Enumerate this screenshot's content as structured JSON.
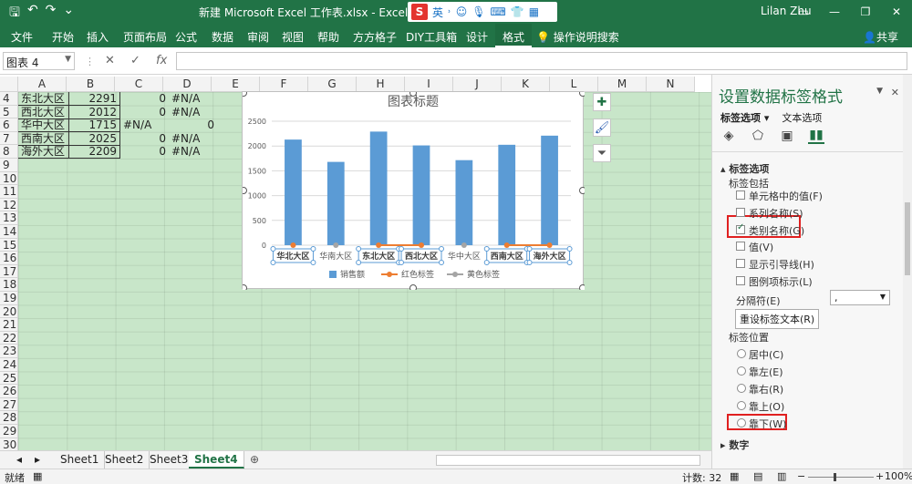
{
  "titlebar": {
    "title": "新建 Microsoft Excel 工作表.xlsx  -  Excel",
    "ime_label": "英",
    "ime_logo": "S",
    "user": "Lilan Zhu",
    "btn_restore": "▭",
    "btn_minimize": "—",
    "btn_maximize": "❐",
    "btn_close": "✕"
  },
  "ribbon": {
    "tabs": [
      "文件",
      "开始",
      "插入",
      "页面布局",
      "公式",
      "数据",
      "审阅",
      "视图",
      "帮助",
      "方方格子",
      "DIY工具箱",
      "设计",
      "格式"
    ],
    "tellme": "操作说明搜索",
    "share": "共享"
  },
  "formula_bar": {
    "name_box": "图表 4",
    "fx": "fx",
    "formula": ""
  },
  "grid": {
    "columns": [
      "A",
      "B",
      "C",
      "D",
      "E",
      "F",
      "G",
      "H",
      "I",
      "J",
      "K",
      "L",
      "M",
      "N"
    ],
    "rows": [
      "4",
      "5",
      "6",
      "7",
      "8",
      "9",
      "10",
      "11",
      "12",
      "13",
      "14",
      "15",
      "16",
      "17",
      "18",
      "19",
      "20",
      "21",
      "22",
      "23",
      "24",
      "25",
      "26",
      "27",
      "28",
      "29",
      "30"
    ],
    "data_rows": [
      {
        "a": "东北大区",
        "b": "2291",
        "c": "0",
        "d": "#N/A"
      },
      {
        "a": "西北大区",
        "b": "2012",
        "c": "0",
        "d": "#N/A"
      },
      {
        "a": "华中大区",
        "b": "1715",
        "c": "#N/A",
        "d": "0"
      },
      {
        "a": "西南大区",
        "b": "2025",
        "c": "0",
        "d": "#N/A"
      },
      {
        "a": "海外大区",
        "b": "2209",
        "c": "0",
        "d": "#N/A"
      }
    ]
  },
  "chart_data": {
    "type": "bar",
    "title": "图表标题",
    "categories": [
      "华北大区",
      "华南大区",
      "东北大区",
      "西北大区",
      "华中大区",
      "西南大区",
      "海外大区"
    ],
    "series": [
      {
        "name": "销售额",
        "values": [
          2130,
          1680,
          2291,
          2012,
          1715,
          2025,
          2209
        ]
      },
      {
        "name": "红色标签",
        "values": [
          0,
          null,
          0,
          0,
          null,
          0,
          0
        ]
      },
      {
        "name": "黄色标签",
        "values": [
          null,
          0,
          null,
          null,
          0,
          null,
          null
        ]
      }
    ],
    "data_labels": [
      "华北大区",
      "华南大区",
      "东北大区",
      "西北大区",
      "华中大区",
      "西南大区",
      "海外大区"
    ],
    "yticks": [
      "0",
      "500",
      "1000",
      "1500",
      "2000",
      "2500"
    ],
    "ylim": [
      0,
      2500
    ],
    "legend_position": "bottom",
    "colors": {
      "bar": "#5b9bd5",
      "red": "#ed7d31",
      "gray": "#a5a5a5"
    }
  },
  "sheets": {
    "tabs": [
      "Sheet1",
      "Sheet2",
      "Sheet3",
      "Sheet4"
    ],
    "active": "Sheet4",
    "add": "⊕"
  },
  "status": {
    "left": "就绪",
    "count": "计数: 32",
    "zoom": "100%"
  },
  "pane": {
    "title": "设置数据标签格式",
    "tab_label": "标签选项 ▾",
    "tab_text": "文本选项",
    "section_title": "▴ 标签选项",
    "contains_label": "标签包括",
    "options": [
      {
        "label": "单元格中的值(F)",
        "checked": false
      },
      {
        "label": "系列名称(S)",
        "checked": false
      },
      {
        "label": "类别名称(G)",
        "checked": true
      },
      {
        "label": "值(V)",
        "checked": false
      },
      {
        "label": "显示引导线(H)",
        "checked": false
      },
      {
        "label": "图例项标示(L)",
        "checked": false
      }
    ],
    "separator_label": "分隔符(E)",
    "separator_value": ",",
    "reset_button": "重设标签文本(R)",
    "position_label": "标签位置",
    "positions": [
      "居中(C)",
      "靠左(E)",
      "靠右(R)",
      "靠上(O)",
      "靠下(W)"
    ],
    "number_section": "▸ 数字"
  }
}
